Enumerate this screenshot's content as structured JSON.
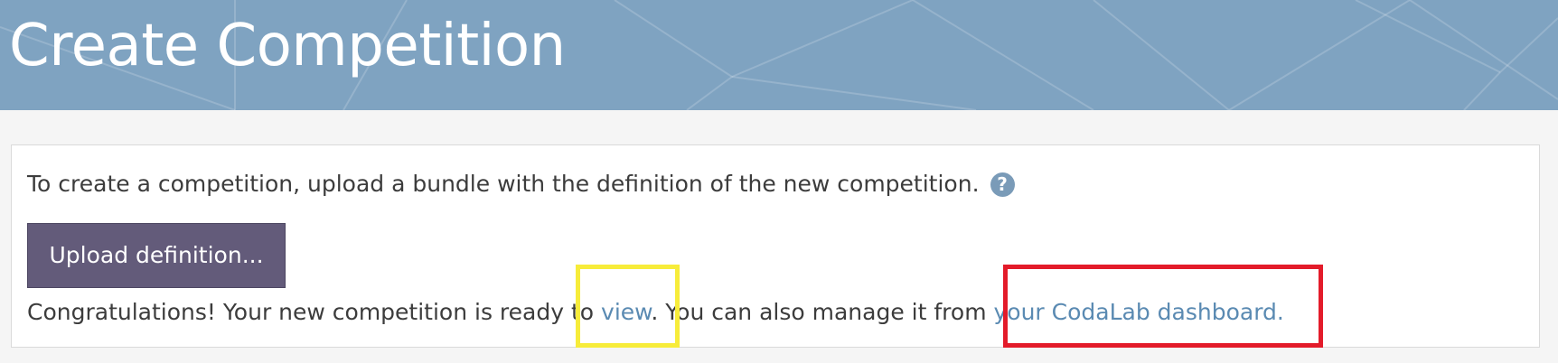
{
  "header": {
    "title": "Create Competition"
  },
  "main": {
    "intro_text": "To create a competition, upload a bundle with the definition of the new competition.",
    "help_icon": "question-circle-icon",
    "help_icon_glyph": "?",
    "upload_button_label": "Upload definition...",
    "congrats": {
      "prefix": "Congratulations! Your new competition is ready to ",
      "view_link": "view",
      "middle": ". You can also manage it from ",
      "dashboard_link": "your CodaLab dashboard."
    }
  },
  "colors": {
    "banner": "#7fa3c1",
    "button": "#635b7a",
    "link": "#5a8ab2",
    "highlight_yellow": "#f7ec3a",
    "highlight_red": "#e31b2a"
  }
}
